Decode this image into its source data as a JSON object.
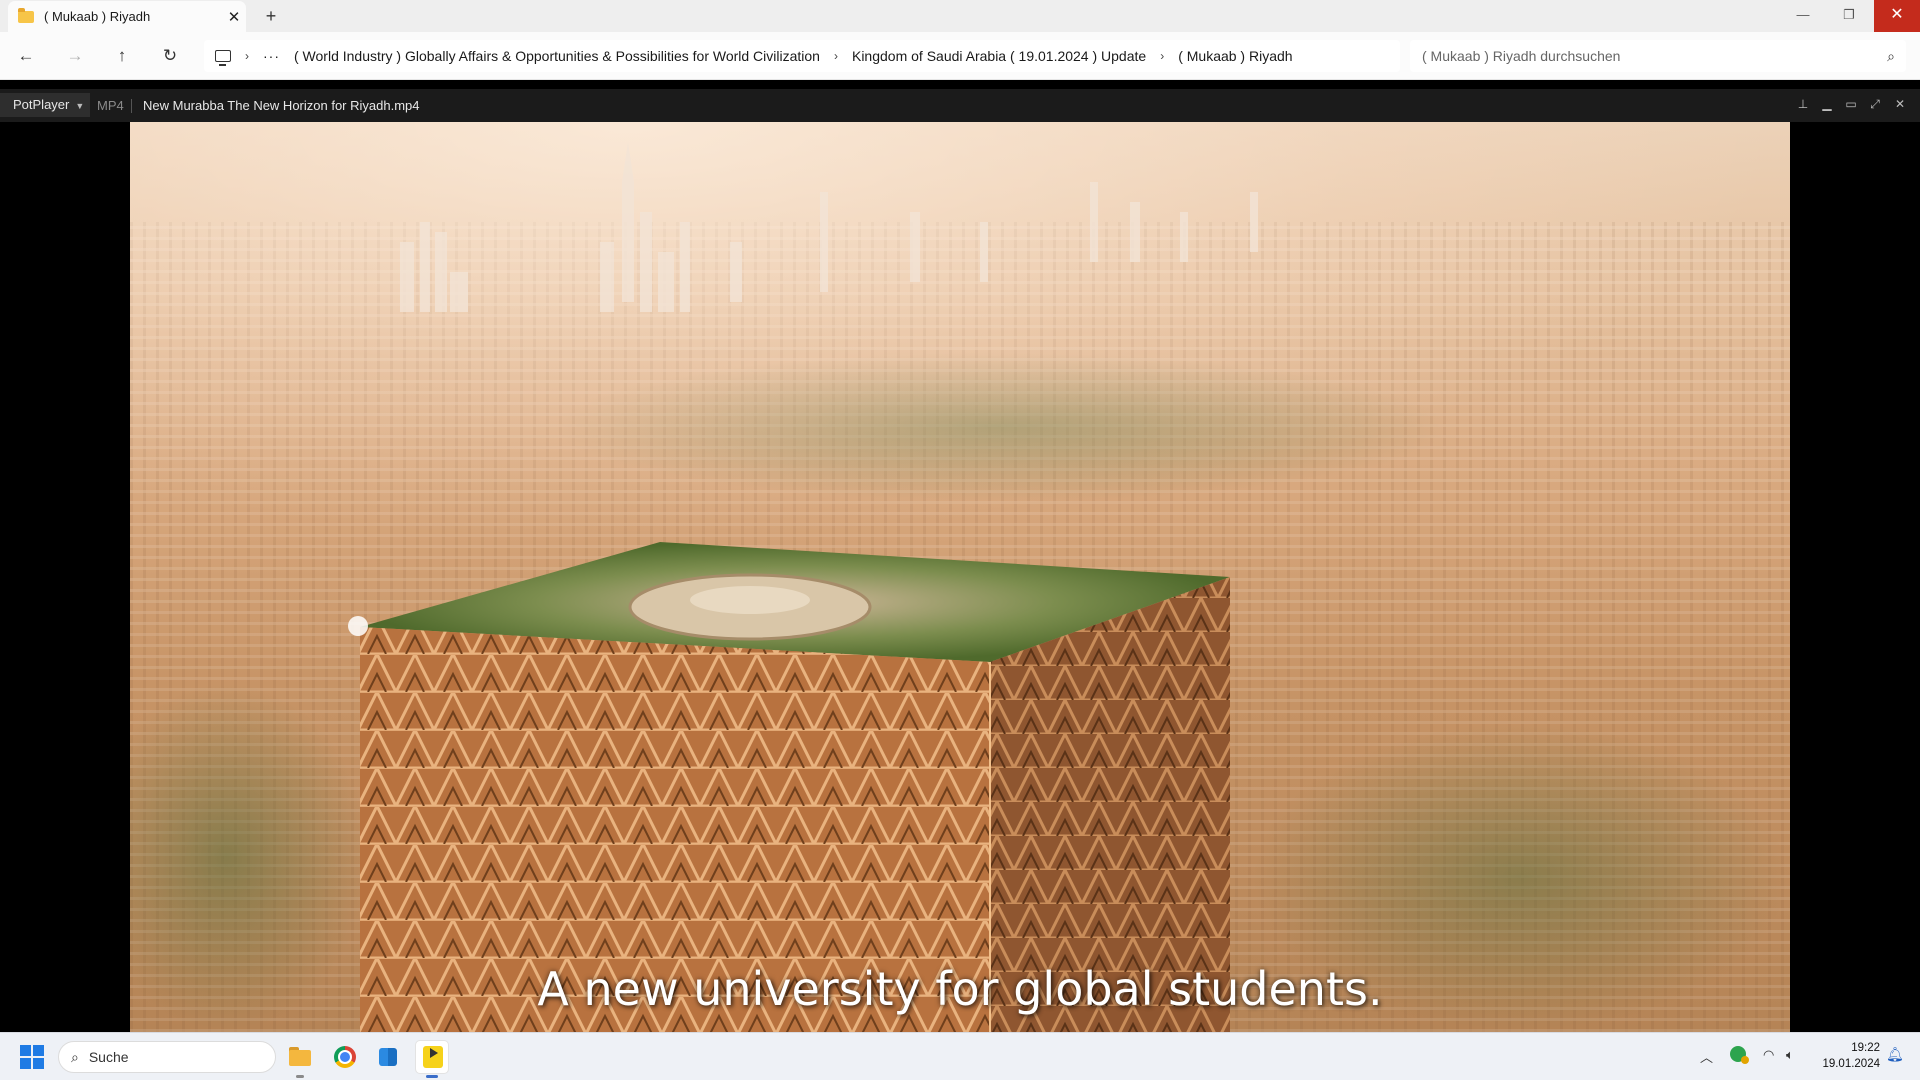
{
  "explorer": {
    "tab_title": "( Mukaab ) Riyadh",
    "tab_close": "✕",
    "new_tab": "+",
    "window_controls": {
      "minimize": "—",
      "maximize": "❐",
      "close": "✕"
    },
    "nav": {
      "back": "←",
      "forward": "→",
      "up": "↑",
      "refresh": "↻"
    },
    "breadcrumbs": [
      "( World Industry ) Globally Affairs & Opportunities & Possibilities for World Civilization",
      "Kingdom of Saudi Arabia ( 19.01.2024 ) Update",
      "( Mukaab ) Riyadh"
    ],
    "breadcrumb_overflow": "···",
    "search_placeholder": "( Mukaab ) Riyadh durchsuchen"
  },
  "player": {
    "menu_label": "PotPlayer",
    "format": "MP4",
    "filename": "New Murabba The New Horizon for Riyadh.mp4",
    "subtitle": "A new university for global students."
  },
  "taskbar": {
    "search_label": "Suche",
    "apps": [
      "file-explorer",
      "chrome",
      "microsoft-store",
      "potplayer"
    ],
    "clock_time": "19:22",
    "clock_date": "19.01.2024"
  },
  "colors": {
    "close_red": "#c42b1c",
    "accent_blue": "#1f7be4",
    "player_bar": "#1b1b1b"
  }
}
